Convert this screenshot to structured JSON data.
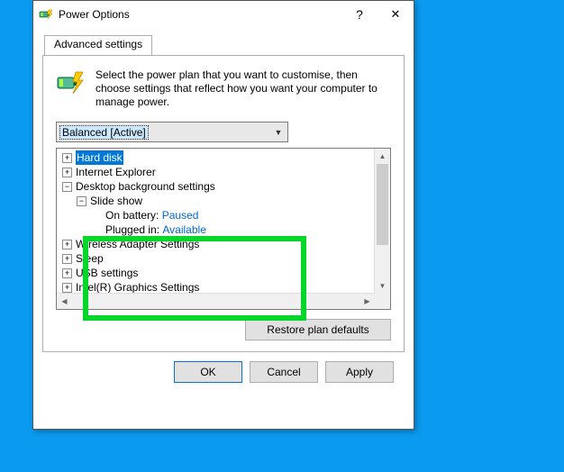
{
  "titlebar": {
    "title": "Power Options",
    "help": "?",
    "close": "✕"
  },
  "tab_label": "Advanced settings",
  "intro_text": "Select the power plan that you want to customise, then choose settings that reflect how you want your computer to manage power.",
  "plan_selected": "Balanced [Active]",
  "tree": {
    "hard_disk": "Hard disk",
    "ie": "Internet Explorer",
    "dbs": "Desktop background settings",
    "slide_show": "Slide show",
    "on_battery_label": "On battery:",
    "on_battery_value": "Paused",
    "plugged_in_label": "Plugged in:",
    "plugged_in_value": "Available",
    "wireless": "Wireless Adapter Settings",
    "sleep": "Sleep",
    "usb": "USB settings",
    "intel": "Intel(R) Graphics Settings"
  },
  "restore_label": "Restore plan defaults",
  "buttons": {
    "ok": "OK",
    "cancel": "Cancel",
    "apply": "Apply"
  }
}
